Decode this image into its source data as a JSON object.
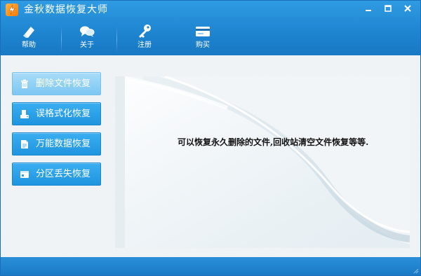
{
  "app": {
    "title": "金秋数据恢复大师",
    "logo_icon": "lightning-logo-icon"
  },
  "window_controls": {
    "minimize_icon": "minimize-icon",
    "maximize_icon": "maximize-icon",
    "close_icon": "close-icon"
  },
  "toolbar": {
    "items": [
      {
        "label": "帮助",
        "icon": "eraser-help-icon"
      },
      {
        "label": "关于",
        "icon": "chat-bubbles-icon"
      },
      {
        "label": "注册",
        "icon": "key-icon"
      },
      {
        "label": "购买",
        "icon": "card-icon"
      }
    ]
  },
  "sidebar": {
    "items": [
      {
        "label": "删除文件恢复",
        "icon": "trash-icon",
        "active": true
      },
      {
        "label": "误格式化恢复",
        "icon": "disk-format-icon",
        "active": false
      },
      {
        "label": "万能数据恢复",
        "icon": "document-icon",
        "active": false
      },
      {
        "label": "分区丢失恢复",
        "icon": "partition-icon",
        "active": false
      }
    ]
  },
  "main": {
    "description": "可以恢复永久删除的文件,回收站清空文件恢复等等."
  },
  "colors": {
    "header": "#1f86d2",
    "button": "#2aa3ea",
    "button_active": "#8fd0f5",
    "statusbar": "#1f83cf"
  }
}
